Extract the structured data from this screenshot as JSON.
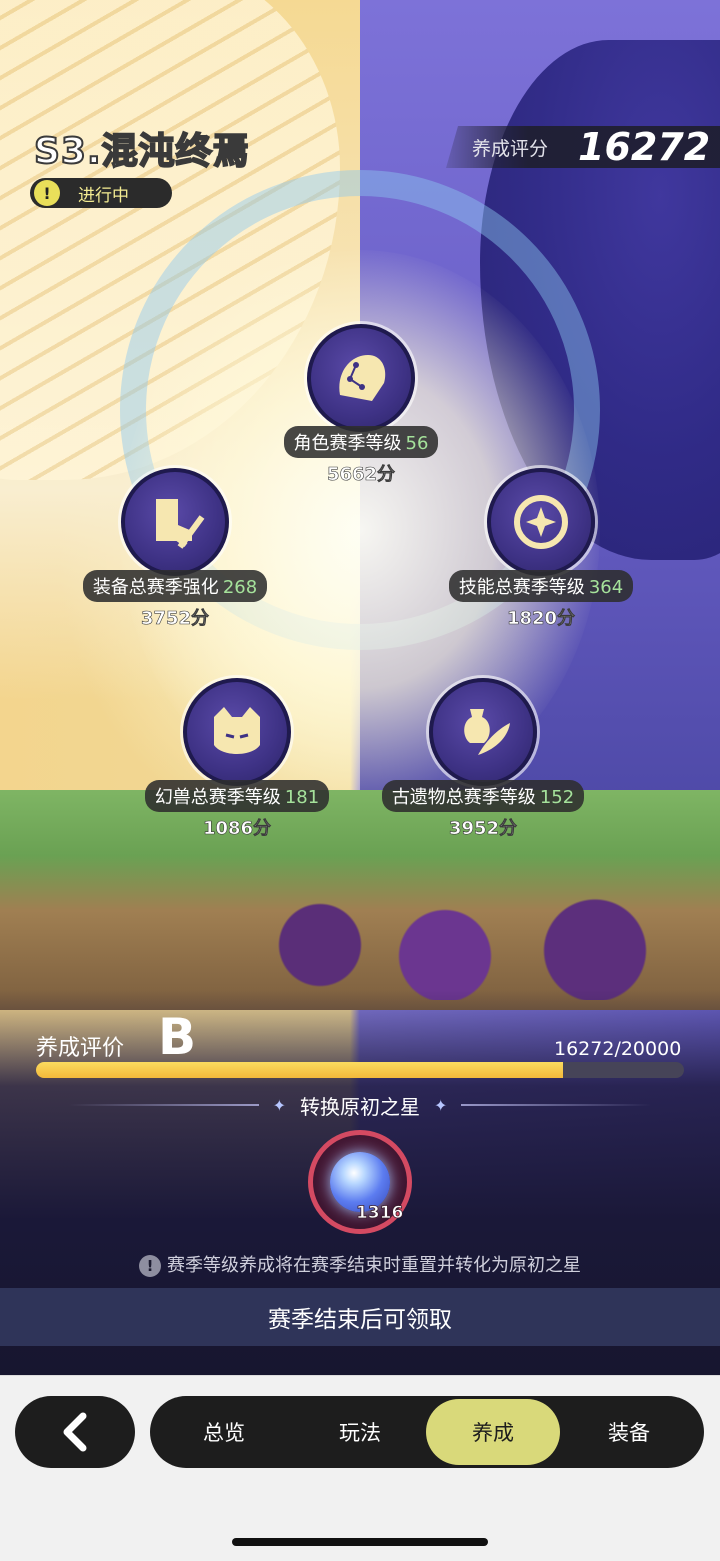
{
  "header": {
    "season_title": "S3.混沌终焉",
    "status_text": "进行中",
    "score_label": "养成评分",
    "score_value": "16272"
  },
  "nodes": [
    {
      "label": "角色赛季等级",
      "level": "56",
      "points": "5662分",
      "icon": "constellation-helmet-icon"
    },
    {
      "label": "装备总赛季强化",
      "level": "268",
      "points": "3752分",
      "icon": "boot-sword-icon"
    },
    {
      "label": "技能总赛季等级",
      "level": "364",
      "points": "1820分",
      "icon": "sparkle-orb-icon"
    },
    {
      "label": "幻兽总赛季等级",
      "level": "181",
      "points": "1086分",
      "icon": "cat-face-icon"
    },
    {
      "label": "古遗物总赛季等级",
      "level": "152",
      "points": "3952分",
      "icon": "vase-feather-icon"
    }
  ],
  "rating": {
    "label": "养成评价",
    "grade": "B",
    "progress_text": "16272/20000",
    "progress_fraction": 0.8136
  },
  "convert": {
    "title": "转换原初之星",
    "item_count": "1316",
    "item_icon": "primal-star-orb-icon",
    "notice": "赛季等级养成将在赛季结束时重置并转化为原初之星"
  },
  "claim_button": "赛季结束后可领取",
  "nav": {
    "back_icon": "chevron-left-icon",
    "tabs": [
      "总览",
      "玩法",
      "养成",
      "装备"
    ],
    "active_tab": "养成"
  },
  "colors": {
    "accent_yellow": "#d9d97a",
    "level_green": "#a5e29b",
    "progress_fill": "#f3b93a",
    "claim_bar": "#2f3459"
  }
}
